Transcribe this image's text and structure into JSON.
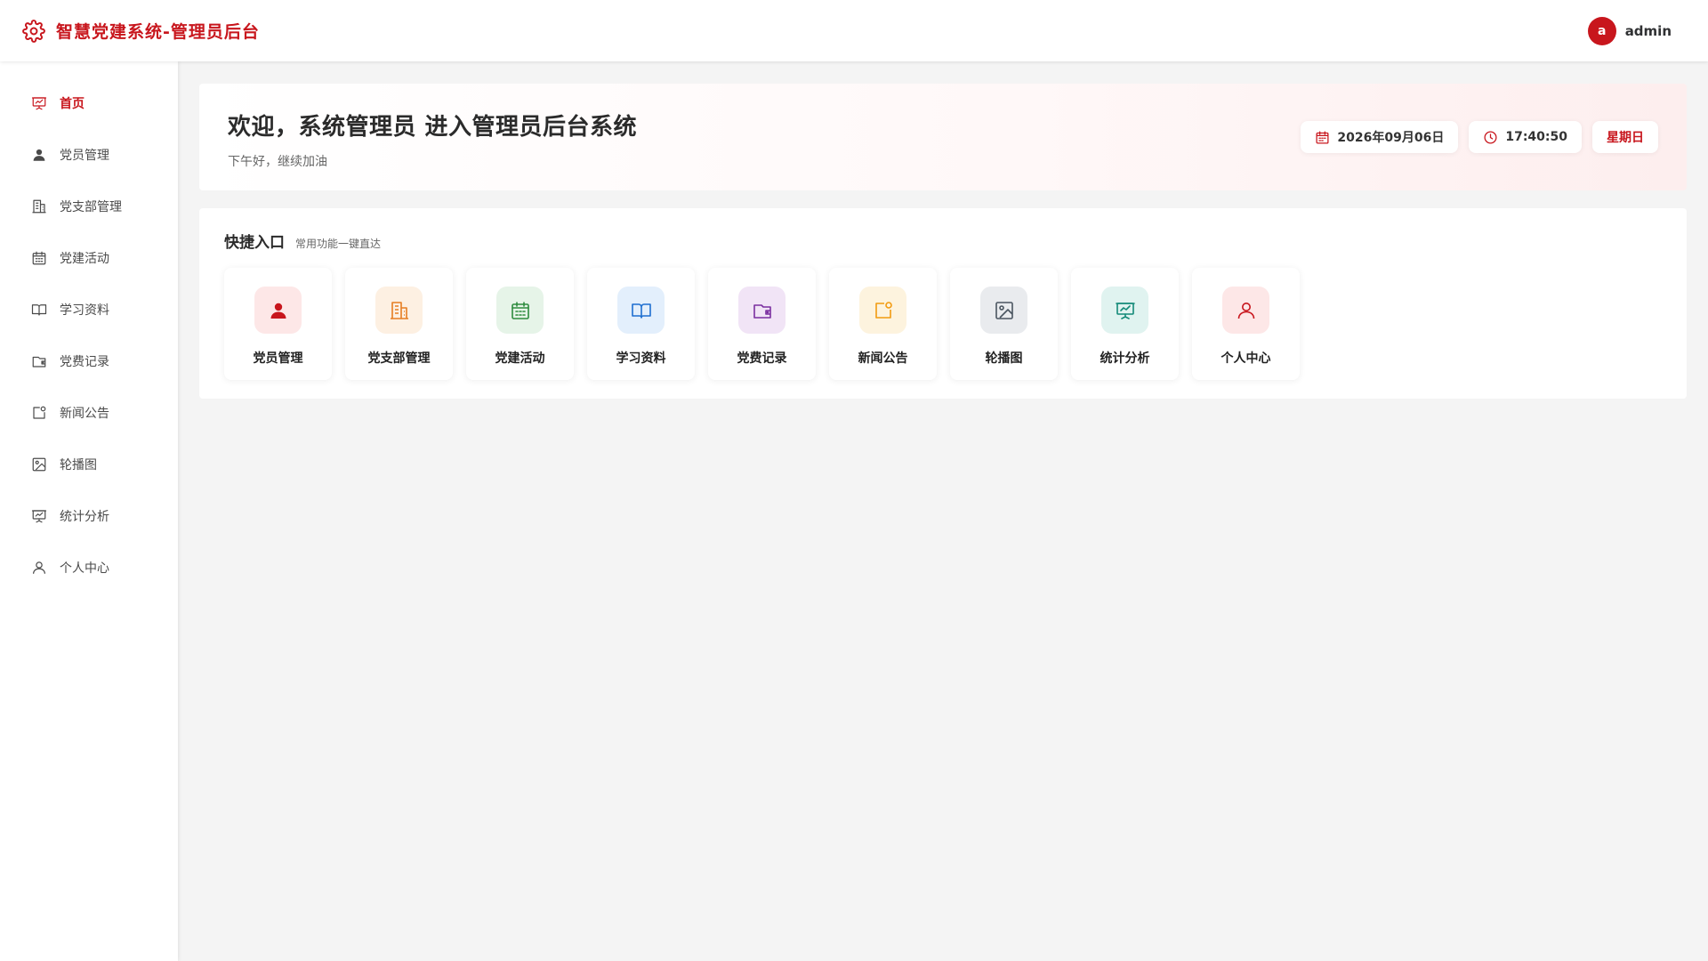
{
  "header": {
    "title": "智慧党建系统-管理员后台",
    "user": {
      "avatar_letter": "a",
      "name": "admin"
    }
  },
  "sidebar": {
    "items": [
      {
        "label": "首页",
        "icon": "presentation-chart-icon",
        "active": true
      },
      {
        "label": "党员管理",
        "icon": "user-icon",
        "active": false
      },
      {
        "label": "党支部管理",
        "icon": "building-icon",
        "active": false
      },
      {
        "label": "党建活动",
        "icon": "calendar-icon",
        "active": false
      },
      {
        "label": "学习资料",
        "icon": "book-icon",
        "active": false
      },
      {
        "label": "党费记录",
        "icon": "wallet-icon",
        "active": false
      },
      {
        "label": "新闻公告",
        "icon": "notice-icon",
        "active": false
      },
      {
        "label": "轮播图",
        "icon": "image-icon",
        "active": false
      },
      {
        "label": "统计分析",
        "icon": "presentation-chart-icon",
        "active": false
      },
      {
        "label": "个人中心",
        "icon": "user-outline-icon",
        "active": false
      }
    ]
  },
  "welcome": {
    "title": "欢迎，系统管理员 进入管理员后台系统",
    "subtitle": "下午好，继续加油",
    "date": "2026年09月06日",
    "time": "17:40:50",
    "weekday": "星期日"
  },
  "quick": {
    "title": "快捷入口",
    "subtitle": "常用功能一键直达",
    "cards": [
      {
        "label": "党员管理",
        "icon": "user-icon",
        "color": "#c8161d",
        "bg": "#fde7e7"
      },
      {
        "label": "党支部管理",
        "icon": "building-icon",
        "color": "#e67e22",
        "bg": "#fdf0e2"
      },
      {
        "label": "党建活动",
        "icon": "calendar-icon",
        "color": "#2e8b3e",
        "bg": "#e6f4e8"
      },
      {
        "label": "学习资料",
        "icon": "book-icon",
        "color": "#1e6fd0",
        "bg": "#e3effc"
      },
      {
        "label": "党费记录",
        "icon": "wallet-icon",
        "color": "#7b2fa0",
        "bg": "#f1e4f6"
      },
      {
        "label": "新闻公告",
        "icon": "notice-icon",
        "color": "#f29b11",
        "bg": "#fdf3de"
      },
      {
        "label": "轮播图",
        "icon": "image-icon",
        "color": "#4a5560",
        "bg": "#e9ebee"
      },
      {
        "label": "统计分析",
        "icon": "presentation-chart-icon",
        "color": "#138a78",
        "bg": "#e0f3f0"
      },
      {
        "label": "个人中心",
        "icon": "user-outline-icon",
        "color": "#c8161d",
        "bg": "#fde7e7"
      }
    ]
  },
  "colors": {
    "brand": "#c8161d",
    "background": "#f4f4f4"
  }
}
